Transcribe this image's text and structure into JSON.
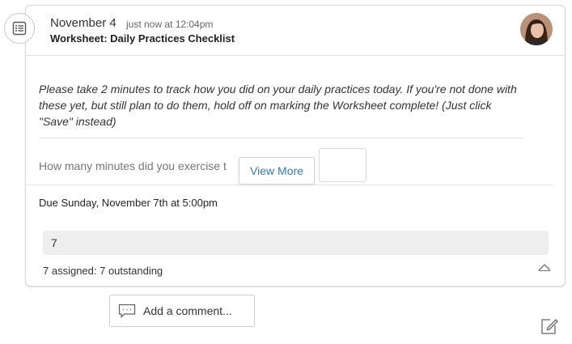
{
  "post": {
    "date": "November 4",
    "time": "just now at 12:04pm",
    "title": "Worksheet: Daily Practices Checklist",
    "type_icon": "list-icon",
    "instructions": "Please take 2 minutes to track how you did on your daily practices today. If you're not done with these yet, but still plan to do them, hold off on marking the Worksheet complete! (Just click \"Save\" instead)",
    "question": "How many minutes did you exercise t",
    "view_more_label": "View More",
    "due": "Due Sunday, November 7th at 5:00pm",
    "count": "7",
    "assigned_summary": "7 assigned: 7 outstanding"
  },
  "comment": {
    "label": "Add a comment...",
    "icon": "comment-icon"
  },
  "colors": {
    "accent": "#2f7dc1",
    "border": "#d6d6d6",
    "count_bar": "#eeeeee"
  }
}
